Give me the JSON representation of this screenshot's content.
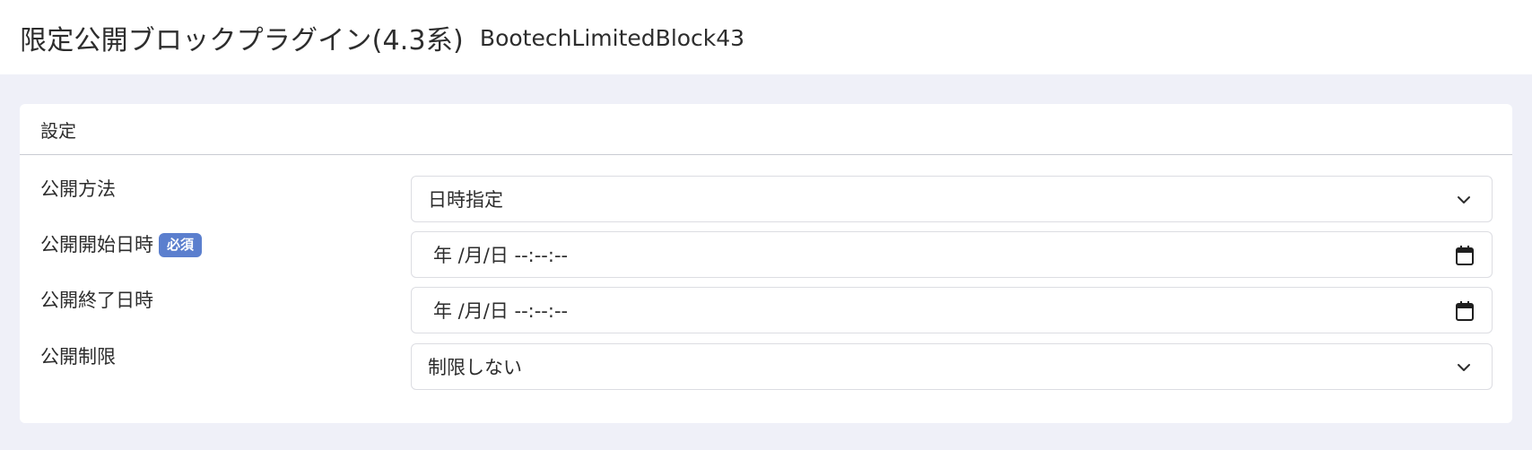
{
  "header": {
    "title": "限定公開ブロックプラグイン(4.3系)",
    "subtitle": "BootechLimitedBlock43"
  },
  "card": {
    "title": "設定"
  },
  "form": {
    "publish_method": {
      "label": "公開方法",
      "value": "日時指定"
    },
    "start_datetime": {
      "label": "公開開始日時",
      "badge": "必須",
      "placeholder": "年 /月/日 --:--:--"
    },
    "end_datetime": {
      "label": "公開終了日時",
      "placeholder": "年 /月/日 --:--:--"
    },
    "restriction": {
      "label": "公開制限",
      "value": "制限しない"
    }
  },
  "colors": {
    "page_background": "#eff0f8",
    "badge_background": "#5b7fce"
  },
  "icons": {
    "select_arrow": "chevron-down-icon",
    "date_picker": "calendar-icon"
  }
}
